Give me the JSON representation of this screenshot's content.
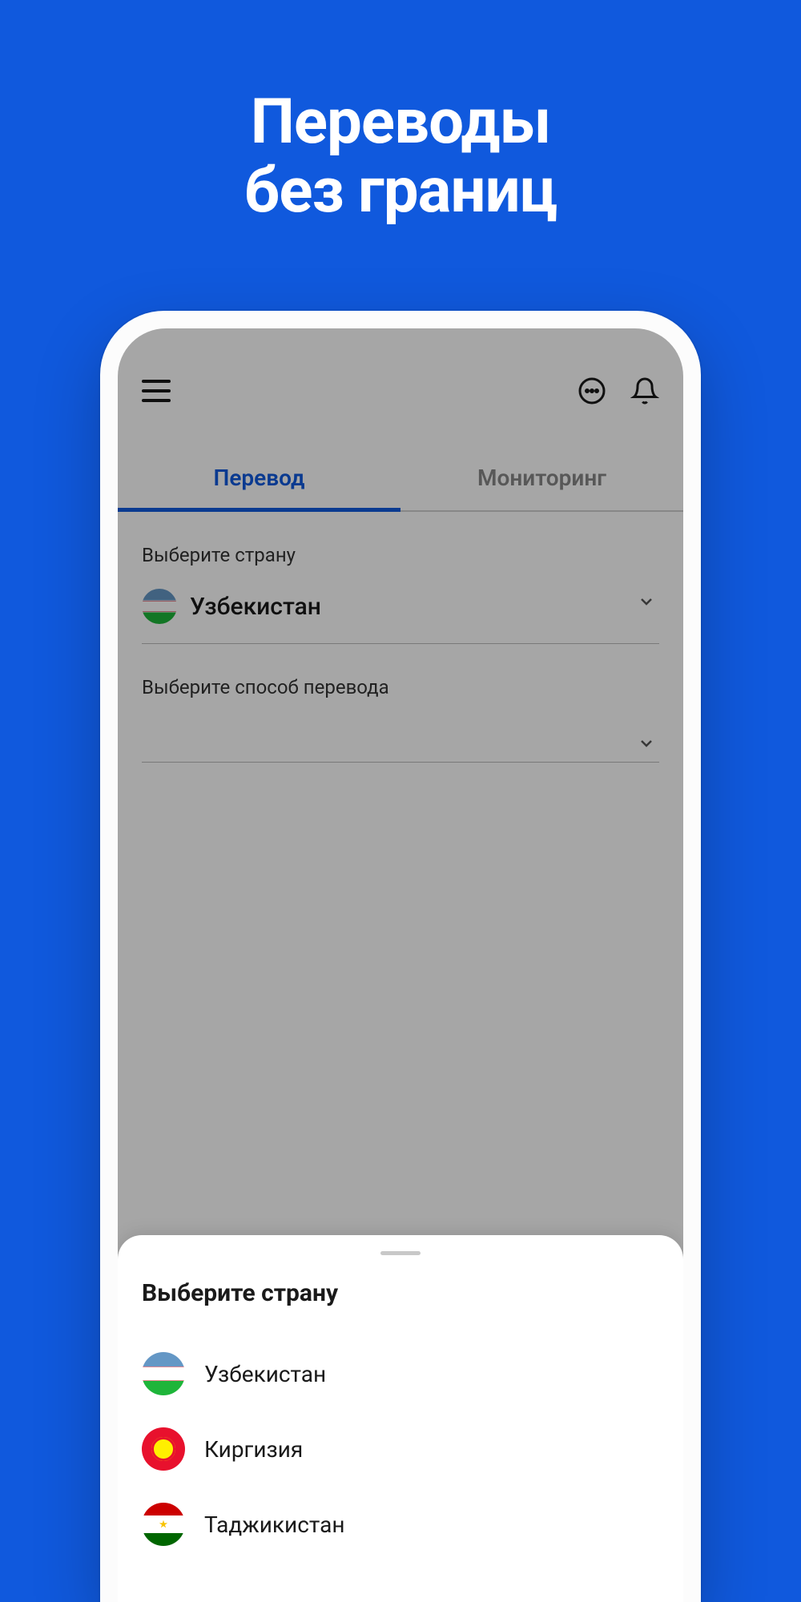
{
  "hero": {
    "line1": "Переводы",
    "line2": "без границ"
  },
  "tabs": {
    "transfer": "Перевод",
    "monitoring": "Мониторинг"
  },
  "form": {
    "country_label": "Выберите страну",
    "selected_country": "Узбекистан",
    "method_label": "Выберите способ перевода"
  },
  "sheet": {
    "title": "Выберите страну",
    "countries": [
      {
        "name": "Узбекистан",
        "flag": "uz"
      },
      {
        "name": "Киргизия",
        "flag": "kg"
      },
      {
        "name": "Таджикистан",
        "flag": "tj"
      }
    ]
  }
}
